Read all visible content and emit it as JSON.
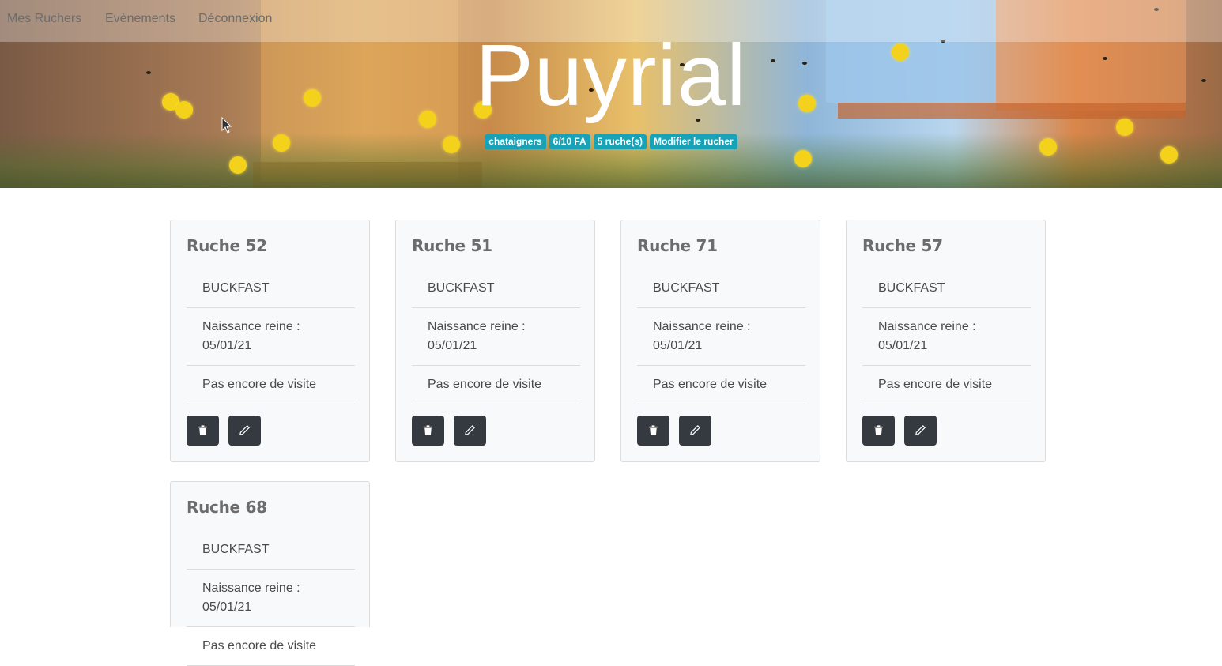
{
  "nav": {
    "items": [
      {
        "label": "Mes Ruchers"
      },
      {
        "label": "Evènements"
      },
      {
        "label": "Déconnexion"
      }
    ]
  },
  "apiary": {
    "name": "Puyrial",
    "badges": [
      "chataigners",
      "6/10 FA",
      "5 ruche(s)",
      "Modifier le rucher"
    ]
  },
  "hives": [
    {
      "title": "Ruche 52",
      "breed": "BUCKFAST",
      "queen_birth": "Naissance reine : 05/01/21",
      "visit": "Pas encore de visite"
    },
    {
      "title": "Ruche 51",
      "breed": "BUCKFAST",
      "queen_birth": "Naissance reine : 05/01/21",
      "visit": "Pas encore de visite"
    },
    {
      "title": "Ruche 71",
      "breed": "BUCKFAST",
      "queen_birth": "Naissance reine : 05/01/21",
      "visit": "Pas encore de visite"
    },
    {
      "title": "Ruche 57",
      "breed": "BUCKFAST",
      "queen_birth": "Naissance reine : 05/01/21",
      "visit": "Pas encore de visite"
    },
    {
      "title": "Ruche 68",
      "breed": "BUCKFAST",
      "queen_birth": "Naissance reine : 05/01/21",
      "visit": "Pas encore de visite"
    }
  ],
  "icons": {
    "delete": "trash-icon",
    "edit": "pencil-icon"
  },
  "colors": {
    "badge": "#17a2b8",
    "button": "#343a40"
  }
}
